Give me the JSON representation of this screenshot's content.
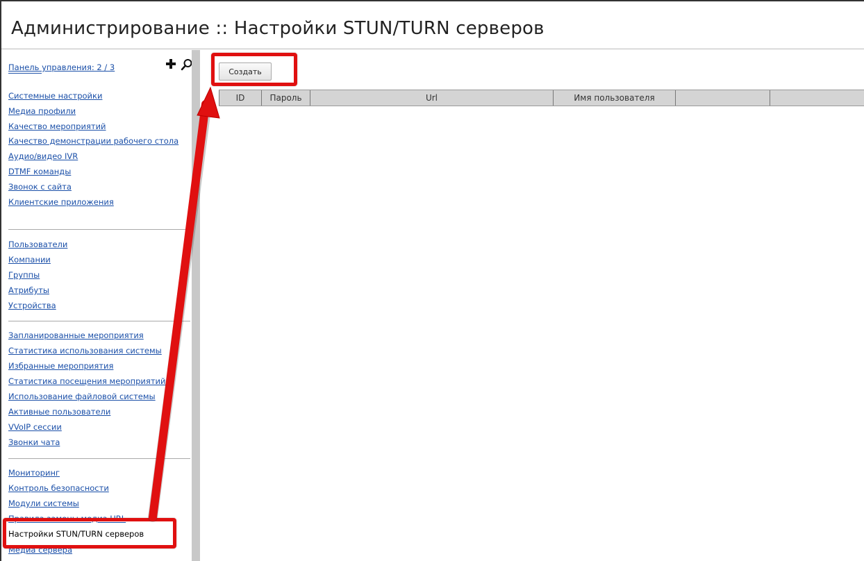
{
  "page": {
    "title": "Администрирование :: Настройки STUN/TURN серверов"
  },
  "sidebar": {
    "panel_link": "Панель управления: 2 / 3",
    "group1": [
      "Системные настройки",
      "Медиа профили",
      "Качество мероприятий",
      "Качество демонстрации рабочего стола",
      "Аудио/видео IVR",
      "DTMF команды",
      "Звонок с сайта",
      "Клиентские приложения"
    ],
    "group2": [
      "Пользователи",
      "Компании",
      "Группы",
      "Атрибуты",
      "Устройства"
    ],
    "group3": [
      "Запланированные мероприятия",
      "Статистика использования системы",
      "Избранные мероприятия",
      "Статистика посещения мероприятий",
      "Использование файловой системы",
      "Активные пользователи",
      "VVoIP сессии",
      "Звонки чата"
    ],
    "group4": [
      "Мониторинг",
      "Контроль безопасности",
      "Модули системы",
      "Правила замены медиа URL"
    ],
    "active_item": "Настройки STUN/TURN серверов",
    "after_active": "Медиа сервера"
  },
  "toolbar": {
    "create_label": "Создать"
  },
  "grid": {
    "columns": [
      "ID",
      "Пароль",
      "Url",
      "Имя пользователя",
      "",
      ""
    ]
  },
  "annotation_color": "#e01010"
}
